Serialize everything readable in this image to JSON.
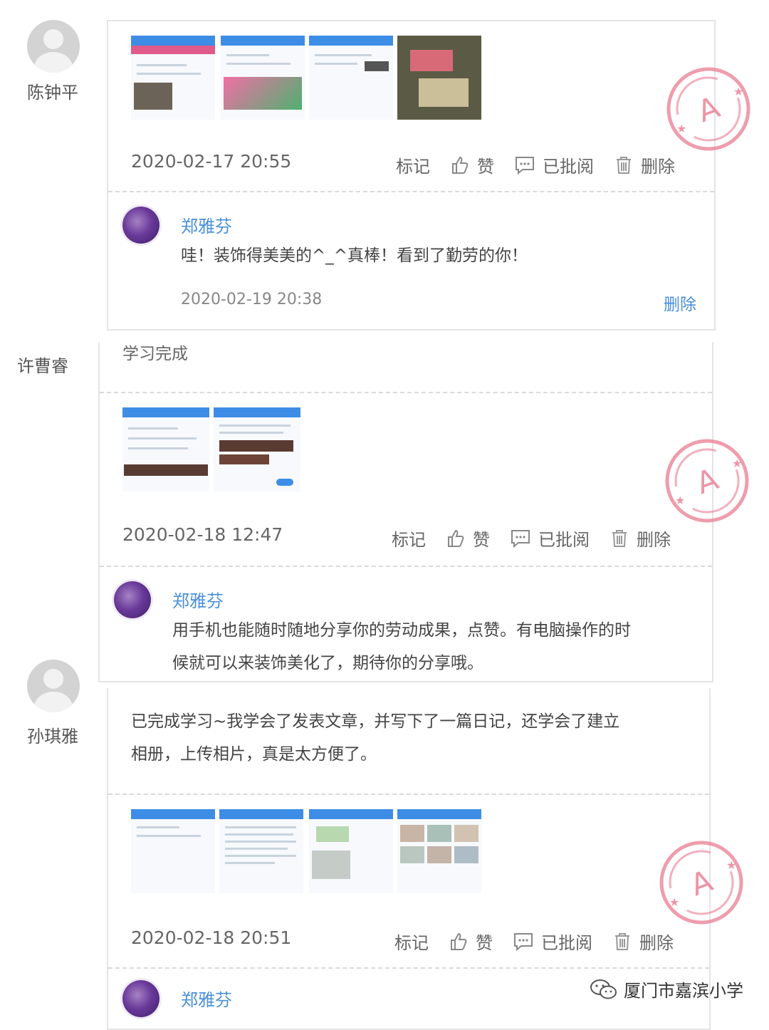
{
  "actions": {
    "mark": "标记",
    "like": "赞",
    "reviewed": "已批阅",
    "delete": "删除"
  },
  "icons": {
    "like": "thumbs-up-icon",
    "comment": "comment-icon",
    "trash": "trash-icon",
    "stamp": "a-star-stamp-icon",
    "wechat": "wechat-icon"
  },
  "colors": {
    "link": "#4a90d9",
    "stamp": "#e87c92",
    "border": "#e4e4e4"
  },
  "stamp_text": "A",
  "posts": [
    {
      "author": "陈钟平",
      "timestamp": "2020-02-17 20:55",
      "comment": {
        "author": "郑雅芬",
        "text": "哇！装饰得美美的^_^真棒！看到了勤劳的你！",
        "timestamp": "2020-02-19 20:38",
        "delete": "删除"
      }
    },
    {
      "author": "许曹睿",
      "text": "学习完成",
      "timestamp": "2020-02-18 12:47",
      "comment": {
        "author": "郑雅芬",
        "text_line1": "用手机也能随时随地分享你的劳动成果，点赞。有电脑操作的时",
        "text_line2": "候就可以来装饰美化了，期待你的分享哦。"
      }
    },
    {
      "author": "孙琪雅",
      "text_line1": "已完成学习~我学会了发表文章，并写下了一篇日记，还学会了建立",
      "text_line2": "相册，上传相片，真是太方便了。",
      "timestamp": "2020-02-18 20:51",
      "comment": {
        "author": "郑雅芬"
      }
    }
  ],
  "watermark": "厦门市嘉滨小学"
}
